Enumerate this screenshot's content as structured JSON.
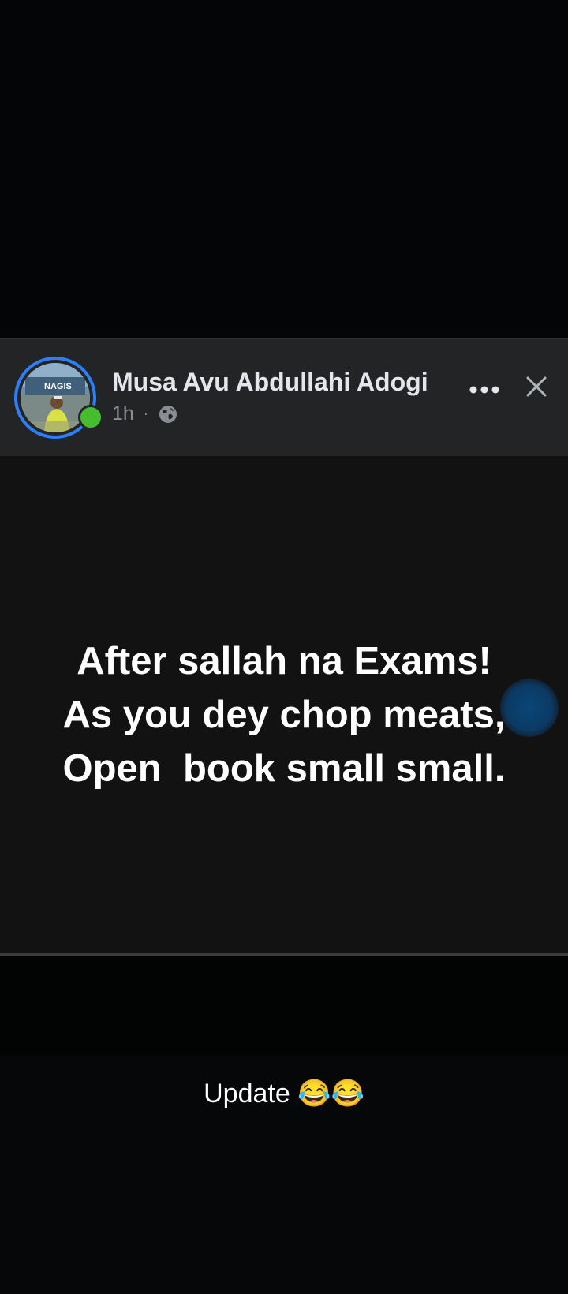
{
  "post": {
    "author_name": "Musa Avu Abdullahi Adogi",
    "timestamp": "1h",
    "separator": "·",
    "privacy_icon": "globe-icon",
    "more_icon": "more-horizontal-icon",
    "close_icon": "close-icon",
    "avatar_sign_text": "NAGIS",
    "text_lines": [
      "After sallah na Exams!",
      "As you dey chop meats,",
      "Open  book small small."
    ]
  },
  "caption": {
    "text": "Update 😂😂"
  },
  "colors": {
    "avatar_ring": "#2d7ff9",
    "online_status": "#45bd2e",
    "header_background": "#232425",
    "post_background": "#121212",
    "page_background": "#050709"
  }
}
